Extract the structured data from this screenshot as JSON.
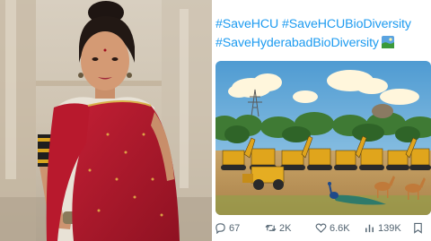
{
  "post": {
    "hashtag_1": "#SaveHCU",
    "hashtag_2": "#SaveHCUBioDiversity",
    "hashtag_3": "#SaveHyderabadBioDiversity",
    "image_icon": "earth-globe-icon"
  },
  "actions": {
    "replies": "67",
    "reposts": "2K",
    "likes": "6.6K",
    "views": "139K"
  },
  "colors": {
    "link": "#1d9bf0",
    "muted": "#536471",
    "saree_red": "#b3182c",
    "sky": "#5fa8d8",
    "machinery_yellow": "#e0a51c"
  }
}
